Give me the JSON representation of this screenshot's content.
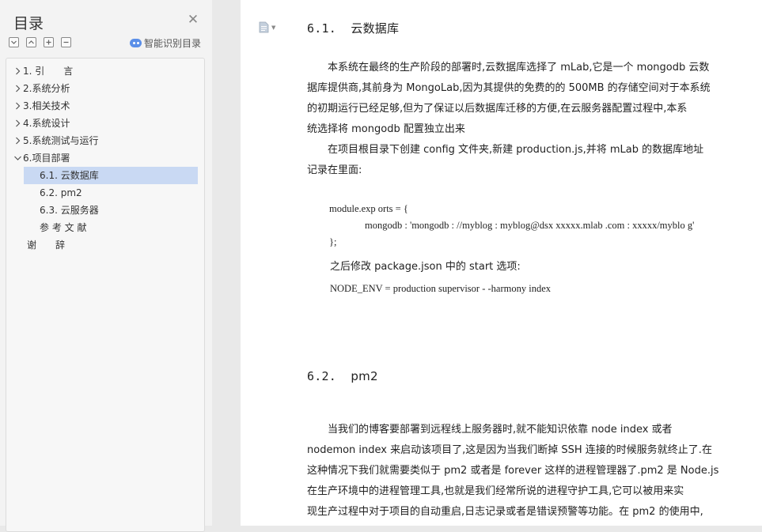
{
  "sidebar": {
    "title": "目录",
    "close_icon": "close-icon",
    "tools": [
      "collapse-all-icon",
      "expand-up-icon",
      "plus-icon",
      "minus-icon"
    ],
    "smart_label": "智能识别目录",
    "items": [
      {
        "label": "1. 引　　言",
        "expandable": true,
        "level": 0
      },
      {
        "label": "2.系统分析",
        "expandable": true,
        "level": 0
      },
      {
        "label": "3.相关技术",
        "expandable": true,
        "level": 0
      },
      {
        "label": "4.系统设计",
        "expandable": true,
        "level": 0
      },
      {
        "label": "5.系统测试与运行",
        "expandable": true,
        "level": 0
      },
      {
        "label": "6.项目部署",
        "expandable": true,
        "expanded": true,
        "level": 0
      },
      {
        "label": "6.1.  云数据库",
        "level": 1,
        "active": true
      },
      {
        "label": "6.2.  pm2",
        "level": 1
      },
      {
        "label": "6.3.  云服务器",
        "level": 1
      },
      {
        "label": "参 考 文 献",
        "level": 1
      },
      {
        "label": "谢　　辞",
        "level": 0
      }
    ]
  },
  "doc": {
    "section1": {
      "number": "6.1.",
      "title": "云数据库",
      "para1_lines": [
        "　　本系统在最终的生产阶段的部署时,云数据库选择了 mLab,它是一个 mongodb 云数",
        "据库提供商,其前身为 MongoLab,因为其提供的免费的的 500MB 的存储空间对于本系统",
        "的初期运行已经足够,但为了保证以后数据库迁移的方便,在云服务器配置过程中,本系",
        "统选择将 mongodb 配置独立出来"
      ],
      "para2_lines": [
        "　　在项目根目录下创建 config 文件夹,新建 production.js,并将 mLab 的数据库地址",
        "记录在里面:"
      ],
      "code_lines": [
        "module.exp orts = {",
        "mongodb : 'mongodb : //myblog : myblog@dsx xxxxx.mlab .com : xxxxx/myblo g'",
        "};"
      ],
      "after_text": "之后修改 package.json 中的 start 选项:",
      "command": "NODE_ENV  = production supervisor - -harmony index"
    },
    "section2": {
      "number": "6.2.",
      "title": "pm2",
      "para_lines": [
        "　　当我们的博客要部署到远程线上服务器时,就不能知识依靠 node index 或者",
        "nodemon index 来启动该项目了,这是因为当我们断掉 SSH 连接的时候服务就终止了.在",
        "这种情况下我们就需要类似于 pm2 或者是 forever 这样的进程管理器了.pm2 是 Node.js",
        "在生产环境中的进程管理工具,也就是我们经常所说的进程守护工具,它可以被用来实",
        "现生产过程中对于项目的自动重启,日志记录或者是错误预警等功能。在 pm2 的使用中,"
      ]
    }
  }
}
